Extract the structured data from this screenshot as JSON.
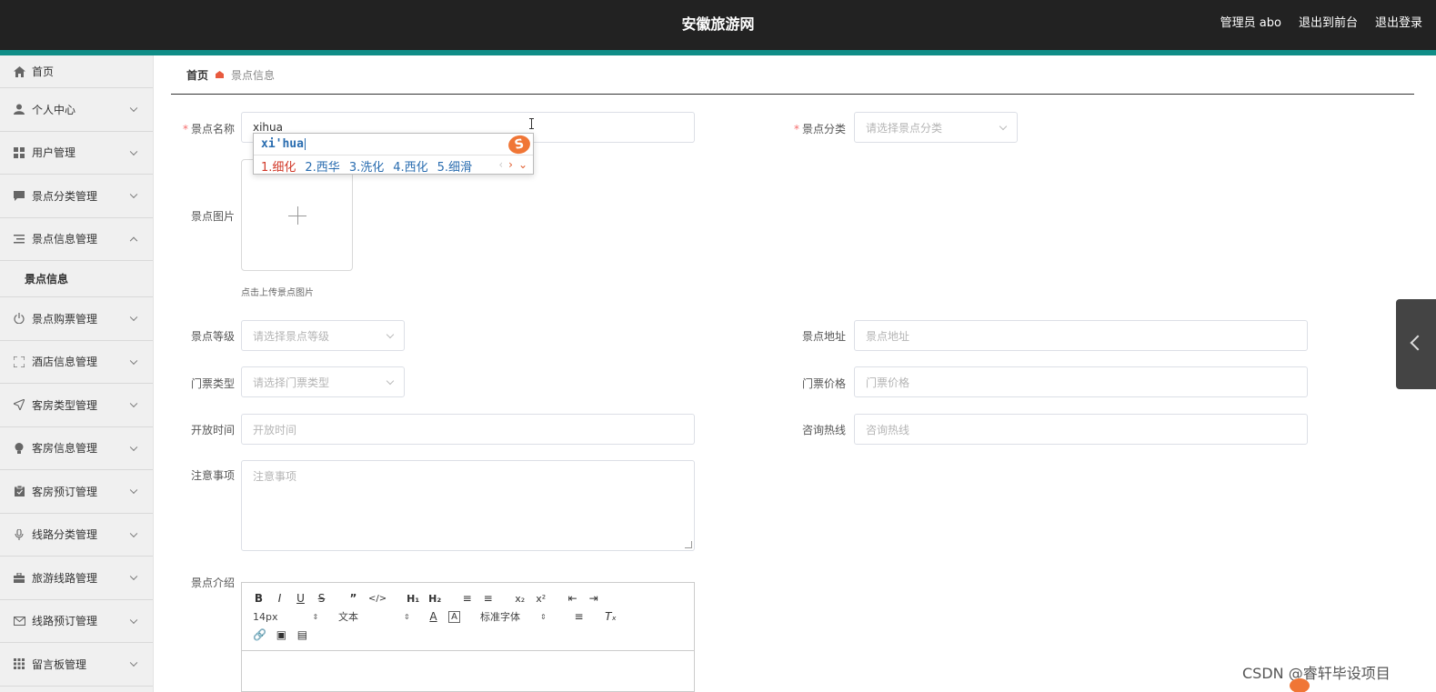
{
  "header": {
    "title": "安徽旅游网",
    "user": "管理员 abo",
    "to_front": "退出到前台",
    "logout": "退出登录"
  },
  "sidebar": {
    "items": [
      {
        "label": "首页",
        "icon": "home-icon"
      },
      {
        "label": "个人中心",
        "icon": "user-icon"
      },
      {
        "label": "用户管理",
        "icon": "grid-icon"
      },
      {
        "label": "景点分类管理",
        "icon": "chat-icon"
      },
      {
        "label": "景点信息管理",
        "icon": "list-icon",
        "expanded": true,
        "children": [
          "景点信息"
        ]
      },
      {
        "label": "景点购票管理",
        "icon": "power-icon"
      },
      {
        "label": "酒店信息管理",
        "icon": "fullscreen-icon"
      },
      {
        "label": "客房类型管理",
        "icon": "send-icon"
      },
      {
        "label": "客房信息管理",
        "icon": "bulb-icon"
      },
      {
        "label": "客房预订管理",
        "icon": "clipboard-icon"
      },
      {
        "label": "线路分类管理",
        "icon": "mic-icon"
      },
      {
        "label": "旅游线路管理",
        "icon": "suitcase-icon"
      },
      {
        "label": "线路预订管理",
        "icon": "mail-icon"
      },
      {
        "label": "留言板管理",
        "icon": "apps-icon"
      }
    ]
  },
  "breadcrumb": {
    "home": "首页",
    "current": "景点信息"
  },
  "form": {
    "name_label": "景点名称",
    "name_value": "xihua",
    "category_label": "景点分类",
    "category_placeholder": "请选择景点分类",
    "image_label": "景点图片",
    "image_tip": "点击上传景点图片",
    "level_label": "景点等级",
    "level_placeholder": "请选择景点等级",
    "address_label": "景点地址",
    "address_placeholder": "景点地址",
    "ticket_type_label": "门票类型",
    "ticket_type_placeholder": "请选择门票类型",
    "price_label": "门票价格",
    "price_placeholder": "门票价格",
    "open_label": "开放时间",
    "open_placeholder": "开放时间",
    "hotline_label": "咨询热线",
    "hotline_placeholder": "咨询热线",
    "notice_label": "注意事项",
    "notice_placeholder": "注意事项",
    "intro_label": "景点介绍"
  },
  "editor": {
    "font_size": "14px",
    "paragraph": "文本",
    "font_family": "标准字体"
  },
  "ime": {
    "pinyin": "xi'hua",
    "candidates": [
      "1.细化",
      "2.西华",
      "3.洗化",
      "4.西化",
      "5.细滑"
    ]
  },
  "watermark": "CSDN @睿轩毕设项目"
}
